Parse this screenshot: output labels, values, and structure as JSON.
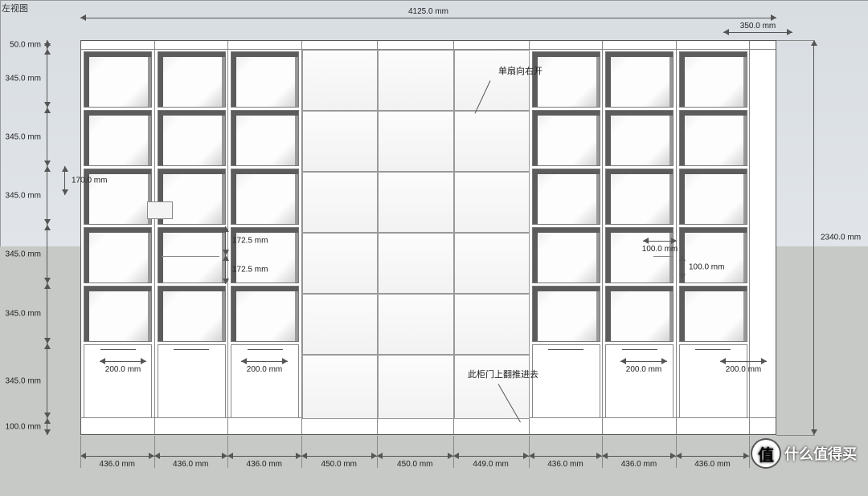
{
  "view_label": "左视图",
  "overall": {
    "width_mm": "4125.0 mm",
    "height_mm": "2340.0 mm",
    "depth_mm": "350.0 mm"
  },
  "rows": {
    "top_panel": "50.0 mm",
    "r1": "345.0 mm",
    "r2": "345.0 mm",
    "r3": "345.0 mm",
    "r4": "345.0 mm",
    "r5": "345.0 mm",
    "r6": "345.0 mm",
    "skirting": "100.0 mm",
    "side_gap": "170.0 mm"
  },
  "cols": [
    "436.0 mm",
    "436.0 mm",
    "436.0 mm",
    "450.0 mm",
    "450.0 mm",
    "449.0 mm",
    "436.0 mm",
    "436.0 mm",
    "436.0 mm"
  ],
  "half_shelf": {
    "upper": "172.5 mm",
    "lower": "172.5 mm"
  },
  "small_shelf": {
    "w": "100.0 mm",
    "gap": "100.0 mm"
  },
  "drawer_handle": "200.0 mm",
  "annotations": {
    "door_single_right": "单扇向右开",
    "flip_up_door": "此柜门上翻推进去"
  },
  "watermark": {
    "logo": "值",
    "text": "什么值得买"
  }
}
